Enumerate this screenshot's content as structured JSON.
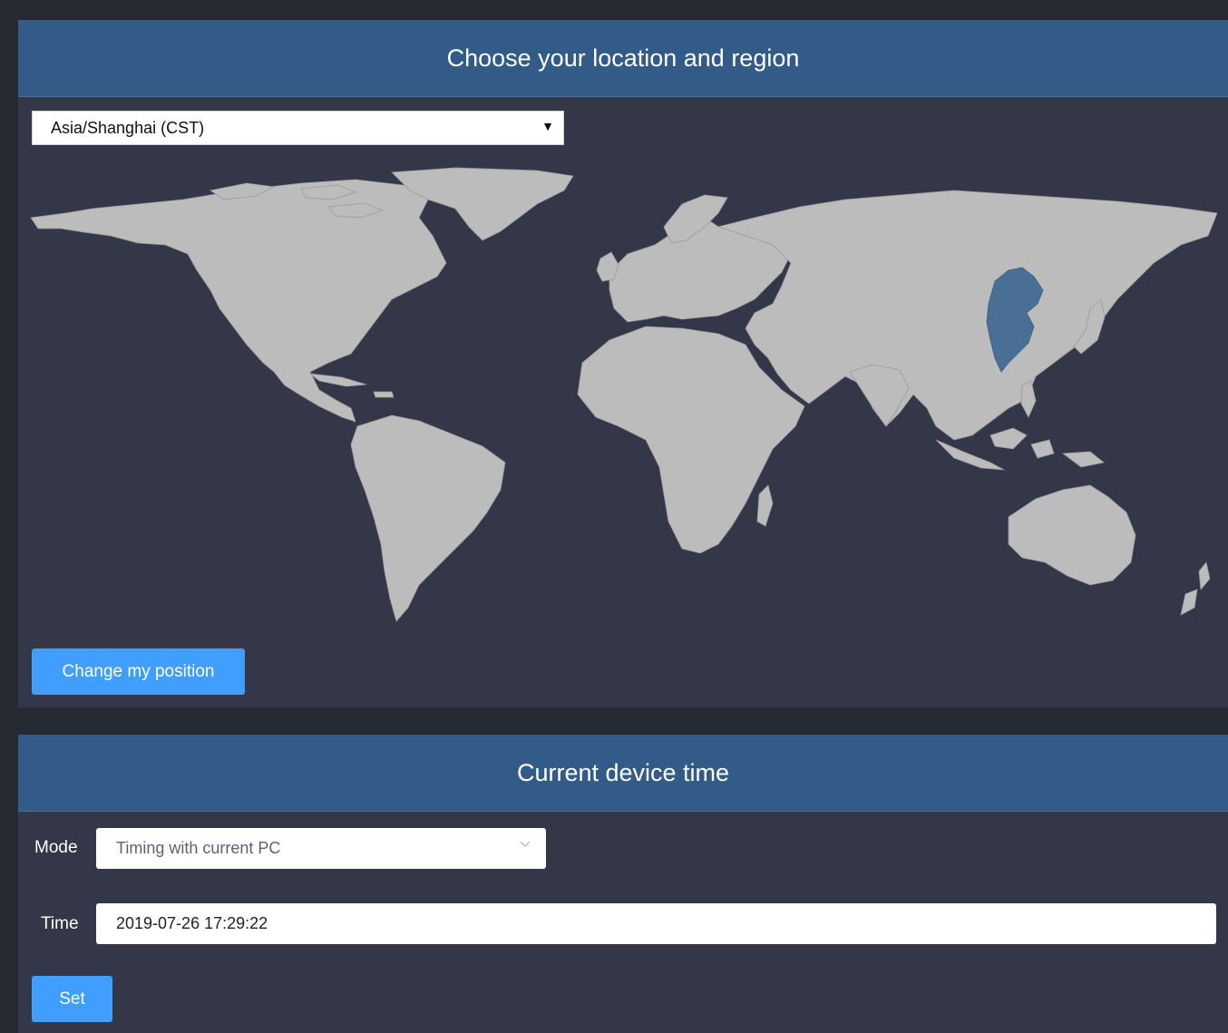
{
  "location_panel": {
    "title": "Choose your location and region",
    "timezone_select": {
      "value": "Asia/Shanghai (CST)",
      "arrow": "▼"
    },
    "map": {
      "selected_region": "China",
      "land_color": "#bcbcbc",
      "selected_color": "#4a6f94",
      "water_color": "#333748"
    },
    "change_button": "Change my position"
  },
  "time_panel": {
    "title": "Current device time",
    "mode_label": "Mode",
    "mode_value": "Timing with current PC",
    "time_label": "Time",
    "time_value": "2019-07-26 17:29:22",
    "set_button": "Set"
  },
  "colors": {
    "header": "#335b88",
    "panel": "#333748",
    "accent": "#409eff"
  }
}
